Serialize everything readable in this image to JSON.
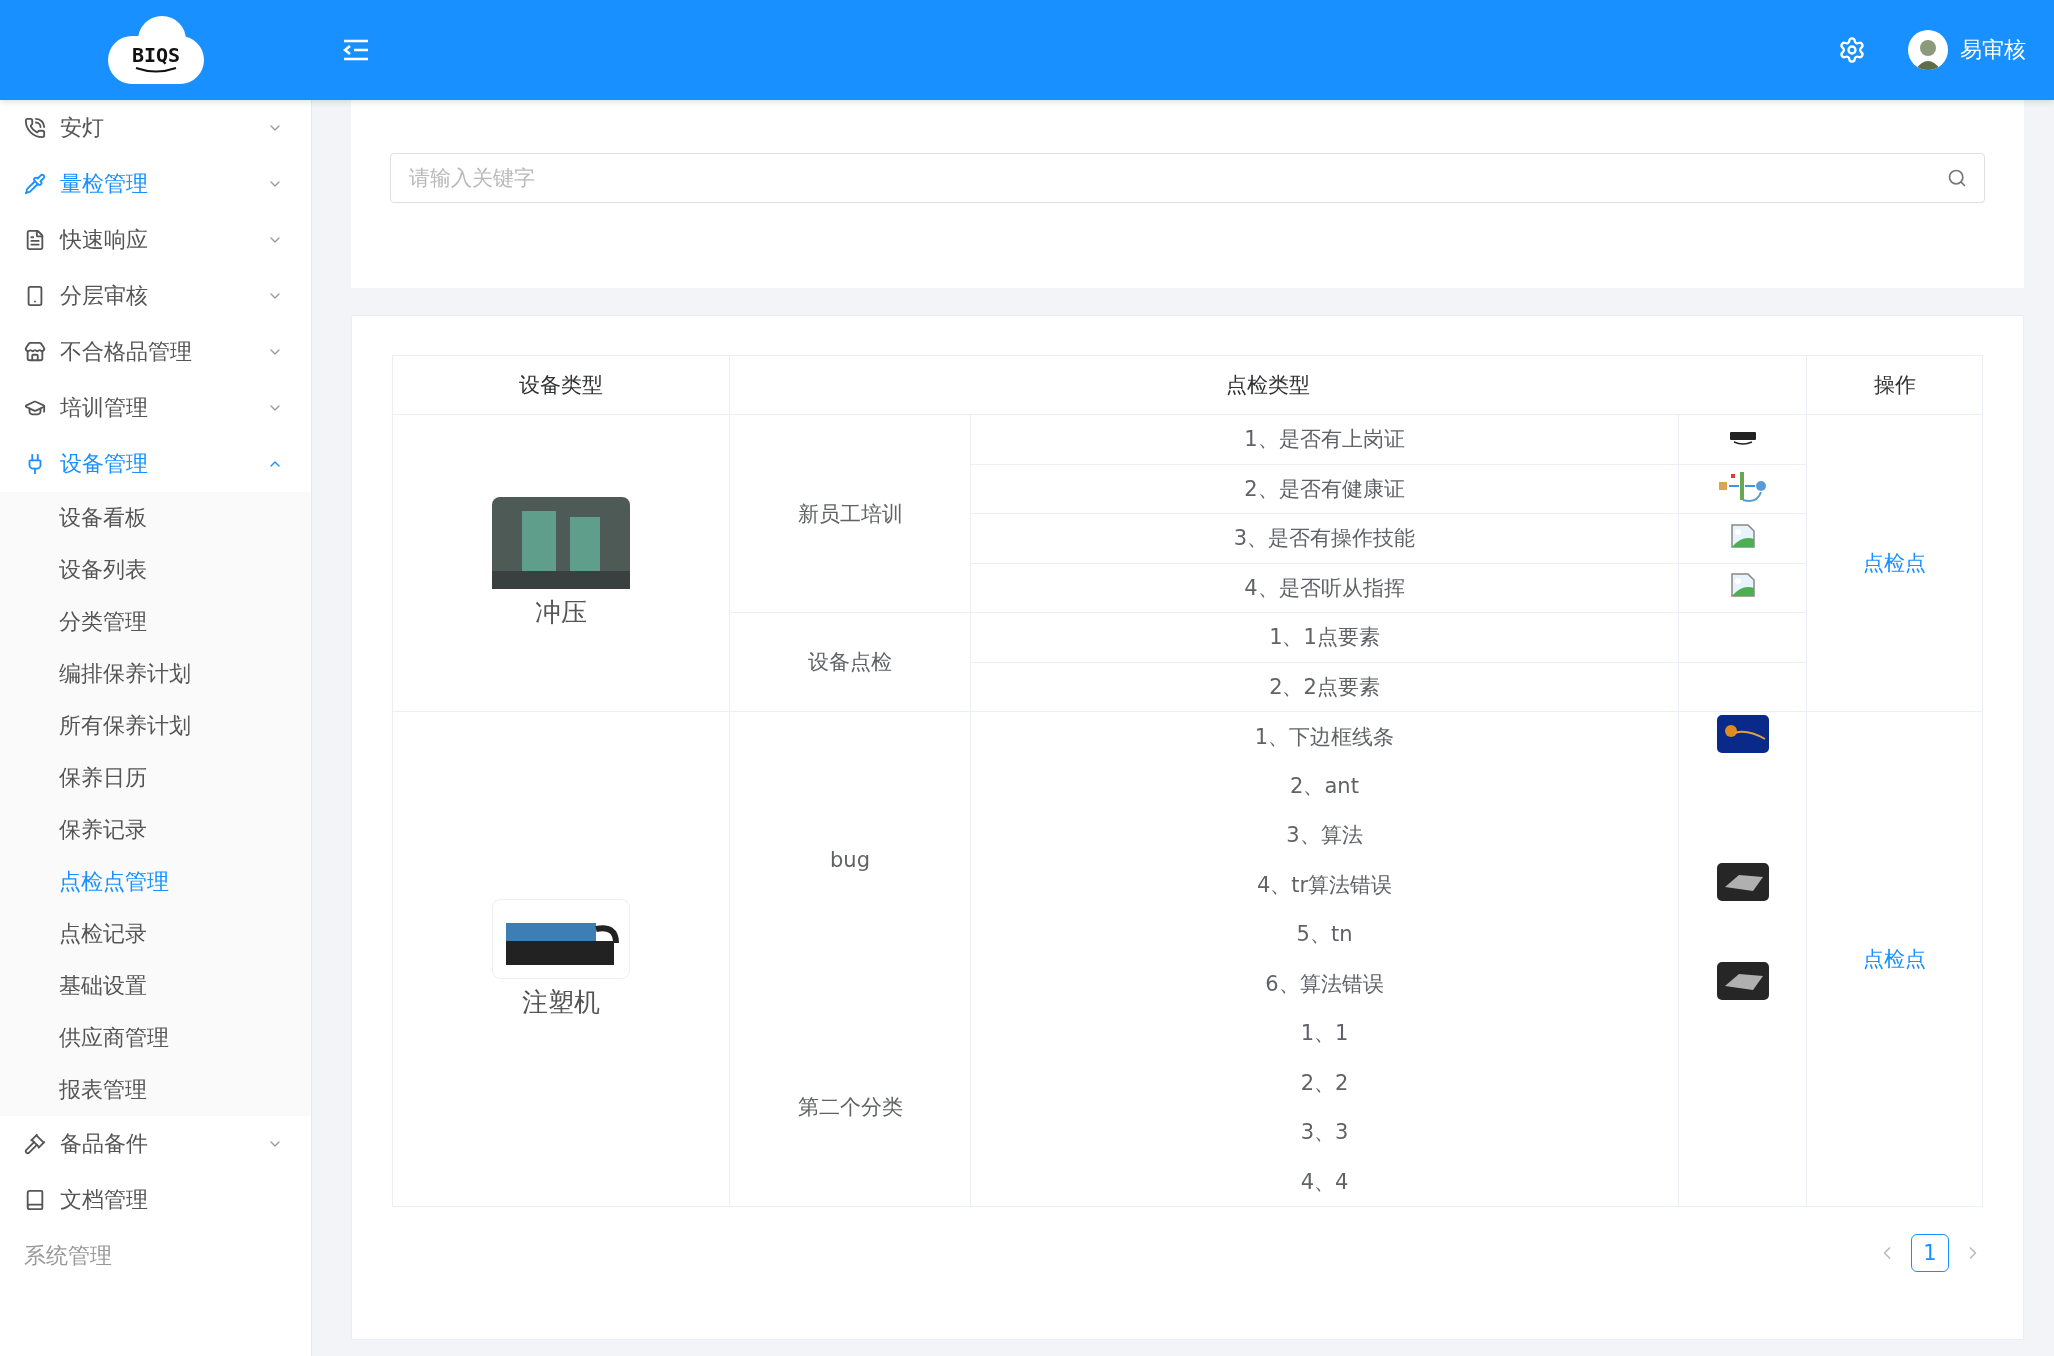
{
  "header": {
    "logo": "BIQS",
    "user": "易审核"
  },
  "sidebar": {
    "items": [
      {
        "kind": "group",
        "label": "安灯",
        "expanded": false,
        "active": false
      },
      {
        "kind": "group",
        "label": "量检管理",
        "expanded": false,
        "active": true
      },
      {
        "kind": "group",
        "label": "快速响应",
        "expanded": false,
        "active": false
      },
      {
        "kind": "group",
        "label": "分层审核",
        "expanded": false,
        "active": false
      },
      {
        "kind": "group",
        "label": "不合格品管理",
        "expanded": false,
        "active": false
      },
      {
        "kind": "group",
        "label": "培训管理",
        "expanded": false,
        "active": false
      },
      {
        "kind": "group",
        "label": "设备管理",
        "expanded": true,
        "active": true,
        "children": [
          {
            "label": "设备看板",
            "selected": false
          },
          {
            "label": "设备列表",
            "selected": false
          },
          {
            "label": "分类管理",
            "selected": false
          },
          {
            "label": "编排保养计划",
            "selected": false
          },
          {
            "label": "所有保养计划",
            "selected": false
          },
          {
            "label": "保养日历",
            "selected": false
          },
          {
            "label": "保养记录",
            "selected": false
          },
          {
            "label": "点检点管理",
            "selected": true
          },
          {
            "label": "点检记录",
            "selected": false
          },
          {
            "label": "基础设置",
            "selected": false
          },
          {
            "label": "供应商管理",
            "selected": false
          },
          {
            "label": "报表管理",
            "selected": false
          }
        ]
      },
      {
        "kind": "group",
        "label": "备品备件",
        "expanded": false,
        "active": false
      },
      {
        "kind": "link",
        "label": "文档管理",
        "active": false
      },
      {
        "kind": "section",
        "label": "系统管理"
      }
    ]
  },
  "search": {
    "placeholder": "请输入关键字"
  },
  "table": {
    "columns": [
      "设备类型",
      "点检类型",
      "操作"
    ],
    "devices": [
      {
        "name": "冲压",
        "row_lines": true,
        "action": "点检点",
        "categories": [
          {
            "name": "新员工培训",
            "items": [
              {
                "text": "1、是否有上岗证"
              },
              {
                "text": "2、是否有健康证"
              },
              {
                "text": "3、是否有操作技能"
              },
              {
                "text": "4、是否听从指挥"
              }
            ]
          },
          {
            "name": "设备点检",
            "items": [
              {
                "text": "1、1点要素"
              },
              {
                "text": "2、2点要素"
              }
            ]
          }
        ]
      },
      {
        "name": "注塑机",
        "row_lines": false,
        "action": "点检点",
        "categories": [
          {
            "name": "bug",
            "items": [
              {
                "text": "1、下边框线条"
              },
              {
                "text": "2、ant"
              },
              {
                "text": "3、算法"
              },
              {
                "text": "4、tr算法错误"
              },
              {
                "text": "5、tn"
              },
              {
                "text": "6、算法错误"
              }
            ]
          },
          {
            "name": "第二个分类",
            "items": [
              {
                "text": "1、1"
              },
              {
                "text": "2、2"
              },
              {
                "text": "3、3"
              },
              {
                "text": "4、4"
              }
            ]
          }
        ]
      }
    ]
  },
  "pagination": {
    "pages": [
      {
        "label": "1",
        "selected": true
      }
    ]
  }
}
